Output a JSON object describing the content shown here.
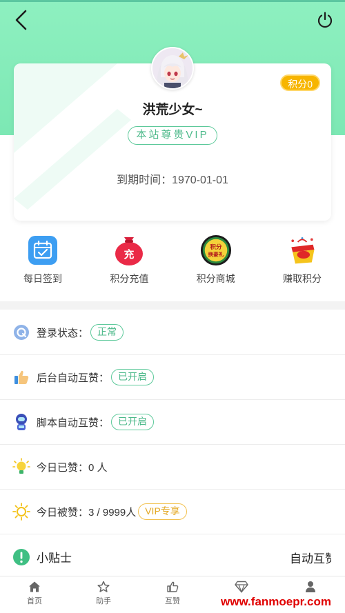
{
  "header": {
    "back_icon": "back-arrow-icon",
    "power_icon": "power-icon",
    "colors": {
      "accent": "#7ce8b4",
      "badge": "#f7b500",
      "tag": "#4cb98a"
    }
  },
  "profile": {
    "points_label": "积分0",
    "username": "洪荒少女~",
    "vip_label": "本站尊贵VIP",
    "expire_label": "到期时间：",
    "expire_value": "1970-01-01"
  },
  "quick_actions": [
    {
      "label": "每日签到",
      "icon": "calendar-check-icon"
    },
    {
      "label": "积分充值",
      "icon": "recharge-bag-icon",
      "icon_text": "充"
    },
    {
      "label": "积分商城",
      "icon": "points-mall-badge-icon",
      "icon_text": "积分换豪礼"
    },
    {
      "label": "赚取积分",
      "icon": "gift-box-icon"
    }
  ],
  "status_list": [
    {
      "label": "登录状态：",
      "value": "正常",
      "style": "green",
      "icon": "q-circle-icon"
    },
    {
      "label": "后台自动互赞：",
      "value": "已开启",
      "style": "green",
      "icon": "thumbs-up-icon"
    },
    {
      "label": "脚本自动互赞：",
      "value": "已开启",
      "style": "green",
      "icon": "robot-icon"
    },
    {
      "label": "今日已赞：0 人",
      "icon": "lightbulb-icon"
    },
    {
      "label": "今日被赞：3 / 9999人",
      "value": "VIP专享",
      "style": "gold",
      "icon": "sun-icon"
    }
  ],
  "tip": {
    "label": "小贴士",
    "marquee_text": "自动互赞",
    "icon": "exclamation-circle-icon"
  },
  "tabbar": [
    {
      "label": "首页",
      "icon": "home-icon"
    },
    {
      "label": "助手",
      "icon": "star-icon"
    },
    {
      "label": "互赞",
      "icon": "thumbs-up-icon"
    },
    {
      "label": "",
      "icon": "diamond-icon"
    },
    {
      "label": "",
      "icon": "user-icon"
    }
  ],
  "watermark": "www.fanmoepr.com"
}
